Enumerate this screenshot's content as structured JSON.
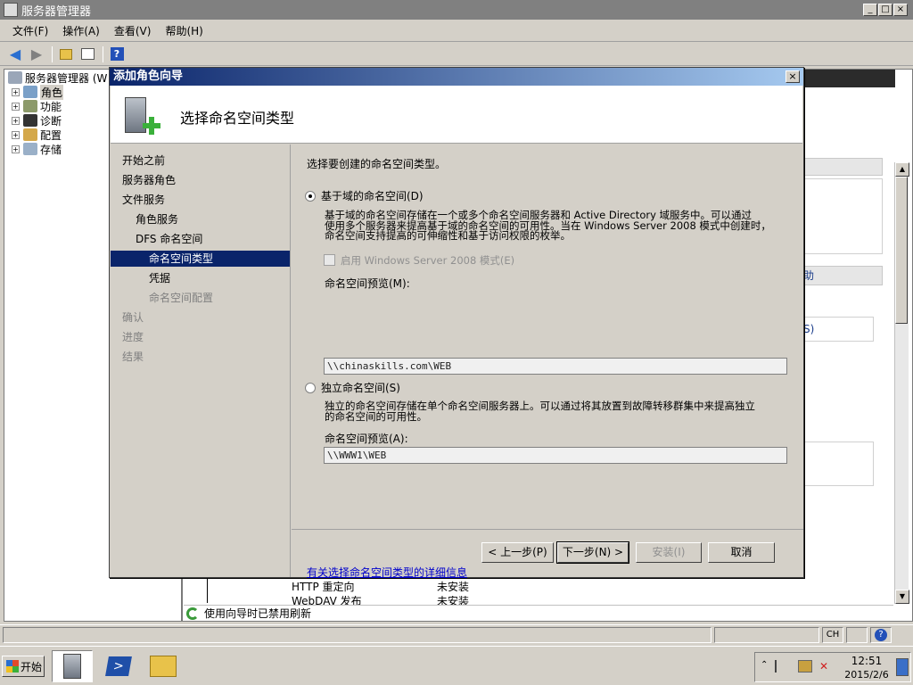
{
  "main_window": {
    "title": "服务器管理器",
    "menu": [
      "文件(F)",
      "操作(A)",
      "查看(V)",
      "帮助(H)"
    ]
  },
  "tree": {
    "root": "服务器管理器 (W",
    "items": [
      "角色",
      "功能",
      "诊断",
      "配置",
      "存储"
    ]
  },
  "right_pane": {
    "partial_label_1": "助",
    "partial_label_2": "S)",
    "rows": [
      {
        "name": "HTTP 重定向",
        "status": "未安装"
      },
      {
        "name": "WebDAV 发布",
        "status": "未安装"
      }
    ],
    "status_text": "使用向导时已禁用刷新"
  },
  "dialog": {
    "title": "添加角色向导",
    "header_title": "选择命名空间类型",
    "nav": [
      {
        "label": "开始之前",
        "state": "normal",
        "indent": 0
      },
      {
        "label": "服务器角色",
        "state": "normal",
        "indent": 0
      },
      {
        "label": "文件服务",
        "state": "normal",
        "indent": 0
      },
      {
        "label": "角色服务",
        "state": "normal",
        "indent": 1
      },
      {
        "label": "DFS 命名空间",
        "state": "normal",
        "indent": 1
      },
      {
        "label": "命名空间类型",
        "state": "selected",
        "indent": 2
      },
      {
        "label": "凭据",
        "state": "normal",
        "indent": 2
      },
      {
        "label": "命名空间配置",
        "state": "disabled",
        "indent": 2
      },
      {
        "label": "确认",
        "state": "disabled",
        "indent": 0
      },
      {
        "label": "进度",
        "state": "disabled",
        "indent": 0
      },
      {
        "label": "结果",
        "state": "disabled",
        "indent": 0
      }
    ],
    "intro": "选择要创建的命名空间类型。",
    "option_domain": {
      "label": "基于域的命名空间(D)",
      "selected": true,
      "desc_lines": [
        "基于域的命名空间存储在一个或多个命名空间服务器和 Active Directory 域服务中。可以通过",
        "使用多个服务器来提高基于域的命名空间的可用性。当在 Windows Server 2008 模式中创建时，",
        "命名空间支持提高的可伸缩性和基于访问权限的枚举。"
      ],
      "checkbox_label": "启用 Windows Server 2008 模式(E)",
      "preview_label": "命名空间预览(M):",
      "preview_value": "\\\\chinaskills.com\\WEB"
    },
    "option_standalone": {
      "label": "独立命名空间(S)",
      "selected": false,
      "desc_lines": [
        "独立的命名空间存储在单个命名空间服务器上。可以通过将其放置到故障转移群集中来提高独立",
        "的命名空间的可用性。"
      ],
      "preview_label": "命名空间预览(A):",
      "preview_value": "\\\\WWW1\\WEB"
    },
    "info_link": "有关选择命名空间类型的详细信息",
    "buttons": {
      "back": "< 上一步(P)",
      "next": "下一步(N) >",
      "install": "安装(I)",
      "cancel": "取消"
    }
  },
  "statusbar": {
    "lang": "CH"
  },
  "taskbar": {
    "start": "开始",
    "time": "12:51",
    "date": "2015/2/6"
  }
}
